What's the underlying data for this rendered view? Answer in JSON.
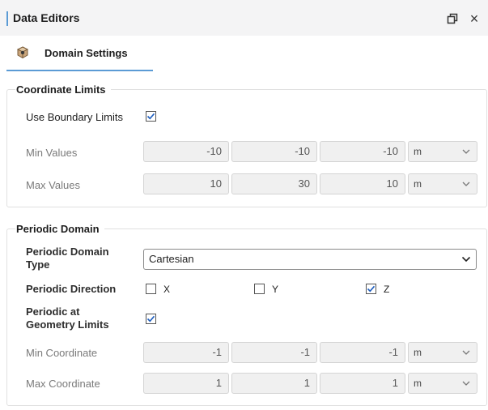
{
  "window": {
    "title": "Data Editors",
    "close_glyph": "×"
  },
  "tab": {
    "label": "Domain Settings",
    "icon": "domain-cube-icon"
  },
  "coordinate_limits": {
    "header": "Coordinate Limits",
    "use_boundary_limits": {
      "label": "Use Boundary Limits",
      "checked": true
    },
    "min": {
      "label": "Min Values",
      "x": "-10",
      "y": "-10",
      "z": "-10",
      "unit": "m"
    },
    "max": {
      "label": "Max Values",
      "x": "10",
      "y": "30",
      "z": "10",
      "unit": "m"
    }
  },
  "periodic_domain": {
    "header": "Periodic Domain",
    "type": {
      "label": "Periodic Domain Type",
      "value": "Cartesian"
    },
    "direction": {
      "label": "Periodic Direction",
      "x": {
        "label": "X",
        "checked": false
      },
      "y": {
        "label": "Y",
        "checked": false
      },
      "z": {
        "label": "Z",
        "checked": true
      }
    },
    "at_geometry_limits": {
      "label": "Periodic at Geometry Limits",
      "checked": true
    },
    "min_coordinate": {
      "label": "Min Coordinate",
      "x": "-1",
      "y": "-1",
      "z": "-1",
      "unit": "m"
    },
    "max_coordinate": {
      "label": "Max Coordinate",
      "x": "1",
      "y": "1",
      "z": "1",
      "unit": "m"
    }
  },
  "colors": {
    "accent": "#5b9bd5",
    "check": "#1f5fbf"
  }
}
